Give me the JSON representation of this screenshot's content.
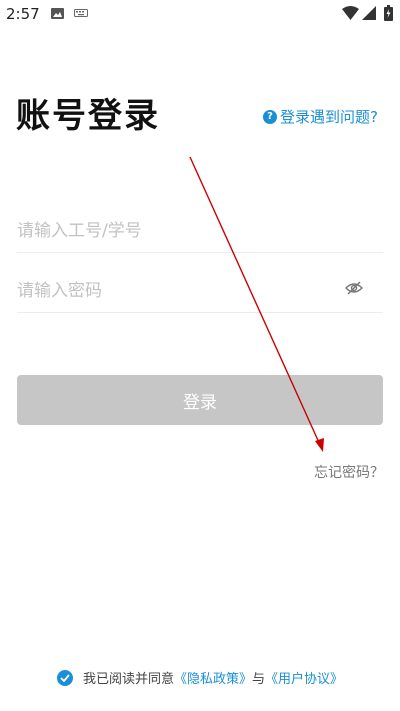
{
  "status_bar": {
    "time": "2:57"
  },
  "header": {
    "title": "账号登录",
    "help_label": "登录遇到问题?"
  },
  "form": {
    "username_placeholder": "请输入工号/学号",
    "password_placeholder": "请输入密码",
    "login_label": "登录",
    "forgot_label": "忘记密码？"
  },
  "agreement": {
    "prefix": "我已阅读并同意",
    "privacy_label": "《隐私政策》",
    "conjunction": "与",
    "terms_label": "《用户协议》"
  },
  "colors": {
    "accent": "#1a8fd6",
    "button_disabled": "#c6c6c6",
    "annotation": "#cc0000"
  }
}
